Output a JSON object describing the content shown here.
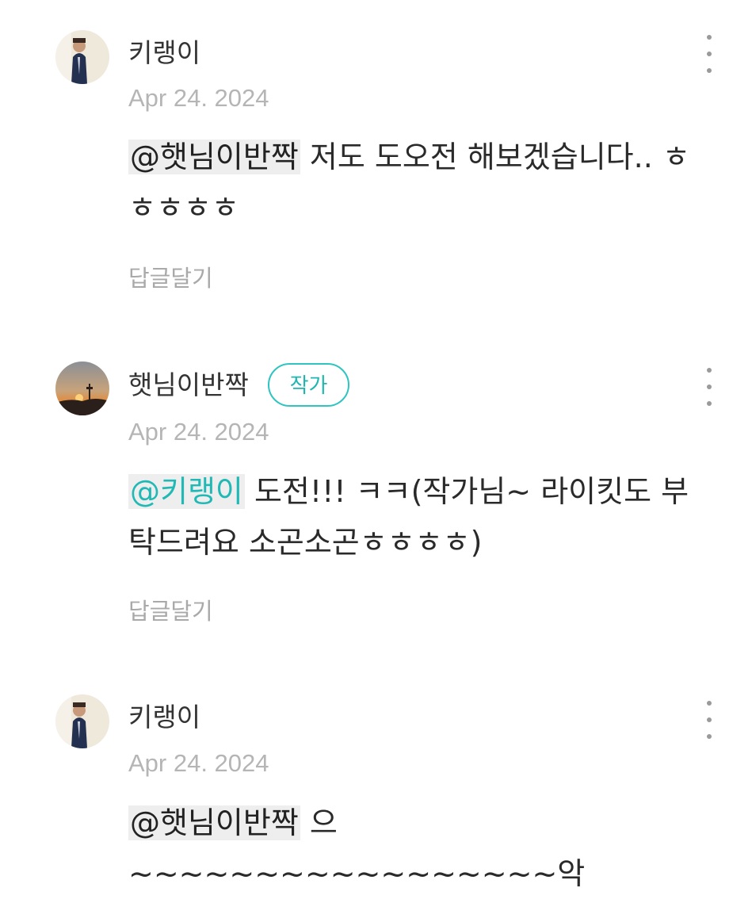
{
  "comments": [
    {
      "author": "키랭이",
      "date": "Apr 24. 2024",
      "mention": "@햇님이반짝",
      "text": " 저도 도오전 해보겠습니다.. ㅎㅎㅎㅎㅎ",
      "reply_label": "답글달기"
    },
    {
      "author": "햇님이반짝",
      "badge": "작가",
      "date": "Apr 24. 2024",
      "mention": "@키랭이",
      "text": " 도전!!! ㅋㅋ(작가님~ 라이킷도 부탁드려요 소곤소곤ㅎㅎㅎㅎ)",
      "reply_label": "답글달기"
    },
    {
      "author": "키랭이",
      "date": "Apr 24. 2024",
      "mention": "@햇님이반짝",
      "text": " 으~~~~~~~~~~~~~~~~~악"
    }
  ],
  "colors": {
    "author_badge": "#2ec4c0",
    "mention_author": "#21b9b5",
    "mention_bg": "#eeeeee",
    "muted": "#b5b5b5"
  },
  "icons": {
    "more": "more-vertical-icon"
  }
}
